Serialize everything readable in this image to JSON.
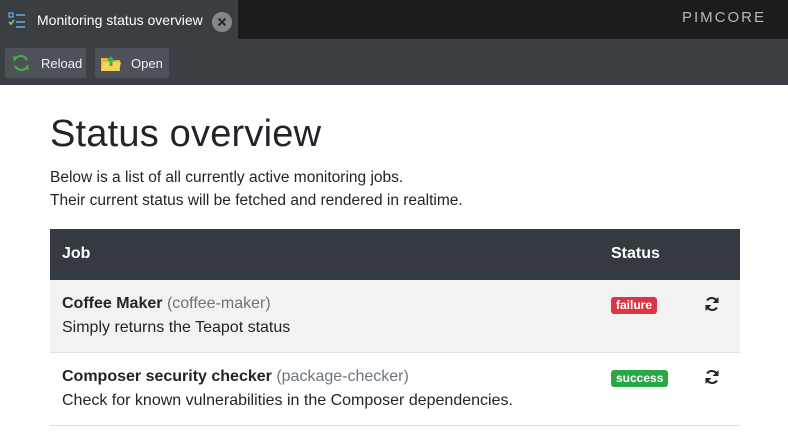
{
  "tab": {
    "title": "Monitoring status overview",
    "icon": "checklist-icon",
    "close_icon": "close-icon"
  },
  "brand": {
    "text": "PIMCORE"
  },
  "toolbar": {
    "reload_label": "Reload",
    "reload_icon": "refresh-icon",
    "open_label": "Open",
    "open_icon": "folder-open-icon"
  },
  "page": {
    "heading": "Status overview",
    "intro_line1": "Below is a list of all currently active monitoring jobs.",
    "intro_line2": "Their current status will be fetched and rendered in realtime."
  },
  "table": {
    "headers": {
      "job": "Job",
      "status": "Status"
    },
    "rows": [
      {
        "name": "Coffee Maker",
        "id": "(coffee-maker)",
        "description": "Simply returns the Teapot status",
        "status": "failure",
        "status_color": "#dc3545"
      },
      {
        "name": "Composer security checker",
        "id": "(package-checker)",
        "description": "Check for known vulnerabilities in the Composer dependencies.",
        "status": "success",
        "status_color": "#28a745"
      }
    ]
  },
  "colors": {
    "tabbar_bg": "#1c1c1e",
    "toolbar_bg": "#3b3e43",
    "table_header_bg": "#343a40",
    "reload_icon_green": "#3fae49",
    "folder_yellow": "#f2c23c"
  }
}
